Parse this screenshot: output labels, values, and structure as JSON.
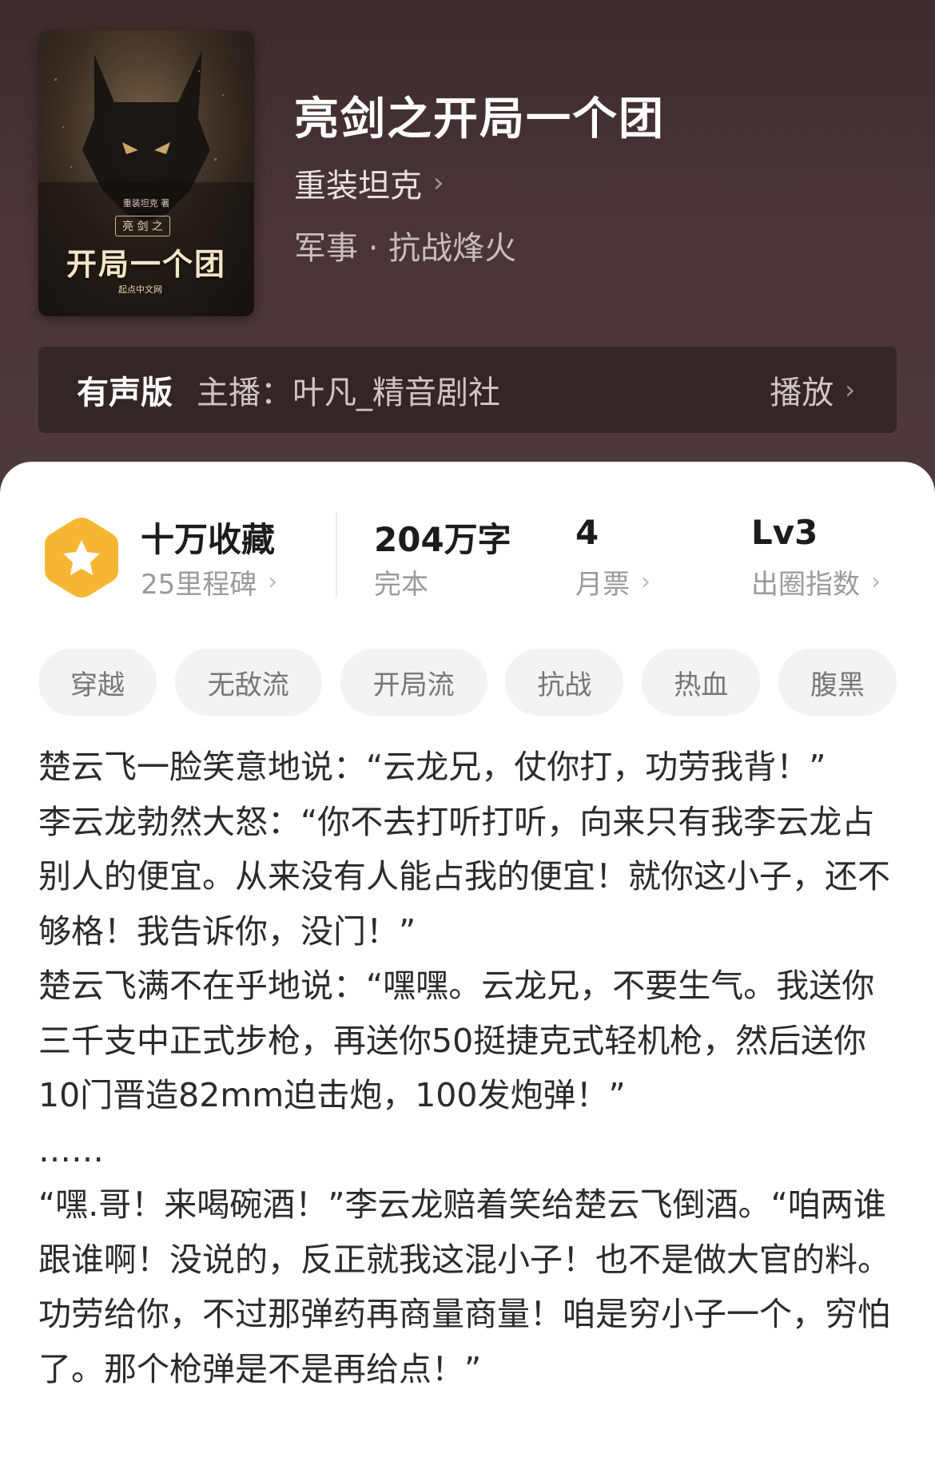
{
  "book": {
    "title": "亮剑之开局一个团",
    "author": "重装坦克",
    "genre": "军事 · 抗战烽火",
    "cover": {
      "author_line": "重装坦克 著",
      "subtitle": "亮 剑 之",
      "title": "开局一个团",
      "publisher": "起点中文网"
    }
  },
  "audio": {
    "label": "有声版",
    "host": "主播：叶凡_精音剧社",
    "play_label": "播放"
  },
  "stats": {
    "collections": "十万收藏",
    "milestones": "25里程碑",
    "word_count": "204万字",
    "status": "完本",
    "monthly_votes": "4",
    "monthly_votes_label": "月票",
    "level": "Lv3",
    "level_label": "出圈指数"
  },
  "tags": [
    "穿越",
    "无敌流",
    "开局流",
    "抗战",
    "热血",
    "腹黑"
  ],
  "intro": [
    "楚云飞一脸笑意地说：“云龙兄，仗你打，功劳我背！”",
    "李云龙勃然大怒：“你不去打听打听，向来只有我李云龙占别人的便宜。从来没有人能占我的便宜！就你这小子，还不够格！我告诉你，没门！”",
    "楚云飞满不在乎地说：“嘿嘿。云龙兄，不要生气。我送你三千支中正式步枪，再送你50挺捷克式轻机枪，然后送你10门晋造82mm迫击炮，100发炮弹！”",
    "……",
    "“嘿.哥！来喝碗酒！”李云龙赔着笑给楚云飞倒酒。“咱两谁跟谁啊！没说的，反正就我这混小子！也不是做大官的料。功劳给你，不过那弹药再商量商量！咱是穷小子一个，穷怕了。那个枪弹是不是再给点！”"
  ],
  "colors": {
    "header_bg": "#4a3436",
    "audio_bar_bg": "#352626",
    "badge_orange": "#f5b731"
  },
  "icons": {
    "badge": "star-hexagon-icon",
    "chevron": "chevron-right-icon"
  }
}
